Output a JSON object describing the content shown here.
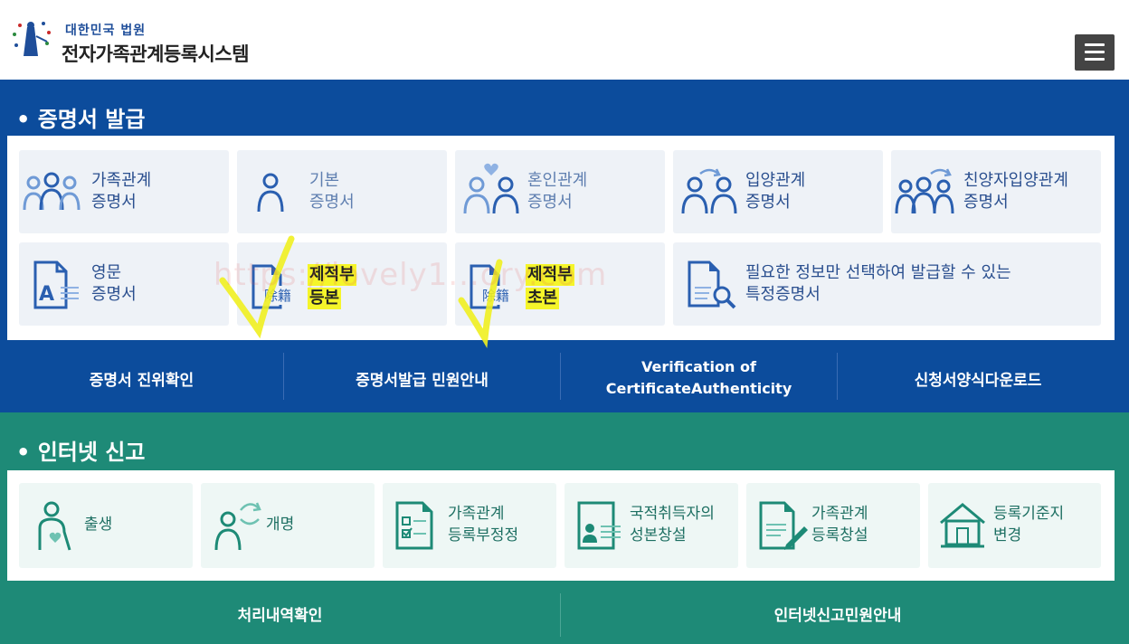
{
  "header": {
    "org_name": "대한민국 법원",
    "system_name": "전자가족관계등록시스템",
    "menu_icon": "hamburger-menu-icon"
  },
  "certificates": {
    "title": "증명서 발급",
    "tiles": [
      {
        "label": "가족관계\n증명서",
        "icon": "family-people-icon"
      },
      {
        "label": "기본\n증명서",
        "icon": "person-icon"
      },
      {
        "label": "혼인관계\n증명서",
        "icon": "couple-heart-icon"
      },
      {
        "label": "입양관계\n증명서",
        "icon": "adoption-people-icon"
      },
      {
        "label": "친양자입양관계\n증명서",
        "icon": "family-adoption-icon"
      },
      {
        "label": "영문\n증명서",
        "icon": "english-document-icon"
      },
      {
        "line1": "제적부",
        "line2": "등본",
        "icon_text": "除籍",
        "icon": "removed-register-document-icon"
      },
      {
        "line1": "제적부",
        "line2": "초본",
        "icon_text": "除籍",
        "icon": "removed-register-document-icon"
      },
      {
        "label": "필요한 정보만 선택하여 발급할 수 있는\n특정증명서",
        "icon": "document-search-icon"
      }
    ],
    "bottom_links": [
      {
        "label": "증명서 진위확인"
      },
      {
        "label": "증명서발급 민원안내"
      },
      {
        "label": "Verification of\nCertificateAuthenticity"
      },
      {
        "label": "신청서양식다운로드"
      }
    ]
  },
  "reports": {
    "title": "인터넷 신고",
    "tiles": [
      {
        "label": "출생",
        "icon": "birth-mother-icon"
      },
      {
        "label": "개명",
        "icon": "rename-person-icon"
      },
      {
        "label": "가족관계\n등록부정정",
        "icon": "checklist-document-icon"
      },
      {
        "label": "국적취득자의\n성본창설",
        "icon": "id-card-icon"
      },
      {
        "label": "가족관계\n등록창설",
        "icon": "document-pen-icon"
      },
      {
        "label": "등록기준지\n변경",
        "icon": "house-icon"
      }
    ],
    "bottom_links": [
      {
        "label": "처리내역확인"
      },
      {
        "label": "인터넷신고민원안내"
      }
    ]
  },
  "watermark": "https://lovely1...ory.com",
  "colors": {
    "cert_blue": "#0c4c9c",
    "report_green": "#1e8a77",
    "highlight_yellow": "#f5f52a"
  }
}
